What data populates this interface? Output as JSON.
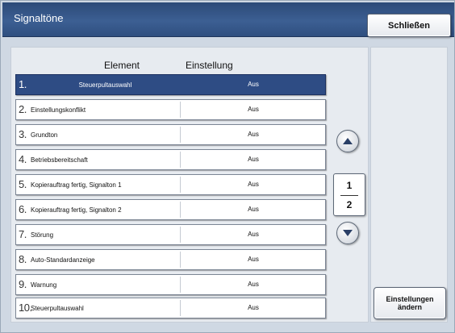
{
  "window": {
    "title": "Signaltöne",
    "close_label": "Schließen"
  },
  "columns": {
    "element": "Element",
    "setting": "Einstellung"
  },
  "rows": [
    {
      "num": "1.",
      "name": "Steuerpultauswahl",
      "value": "Aus",
      "selected": true
    },
    {
      "num": "2.",
      "name": "Einstellungskonflikt",
      "value": "Aus",
      "selected": false
    },
    {
      "num": "3.",
      "name": "Grundton",
      "value": "Aus",
      "selected": false
    },
    {
      "num": "4.",
      "name": "Betriebsbereitschaft",
      "value": "Aus",
      "selected": false
    },
    {
      "num": "5.",
      "name": "Kopierauftrag fertig, Signalton 1",
      "value": "Aus",
      "selected": false
    },
    {
      "num": "6.",
      "name": "Kopierauftrag fertig, Signalton 2",
      "value": "Aus",
      "selected": false
    },
    {
      "num": "7.",
      "name": "Störung",
      "value": "Aus",
      "selected": false
    },
    {
      "num": "8.",
      "name": "Auto-Standardanzeige",
      "value": "Aus",
      "selected": false
    },
    {
      "num": "9.",
      "name": "Warnung",
      "value": "Aus",
      "selected": false
    },
    {
      "num": "10.",
      "name": "Steuerpultauswahl",
      "value": "Aus",
      "selected": false
    }
  ],
  "pagination": {
    "current": "1",
    "total": "2"
  },
  "icons": {
    "scroll_up": "chevron-up-icon",
    "scroll_down": "chevron-down-icon"
  },
  "actions": {
    "change_label": "Einstellungen\nändern"
  },
  "colors": {
    "titlebar": "#2c4a78",
    "selected_row": "#2e4c84",
    "panel": "#e7ebf0"
  }
}
